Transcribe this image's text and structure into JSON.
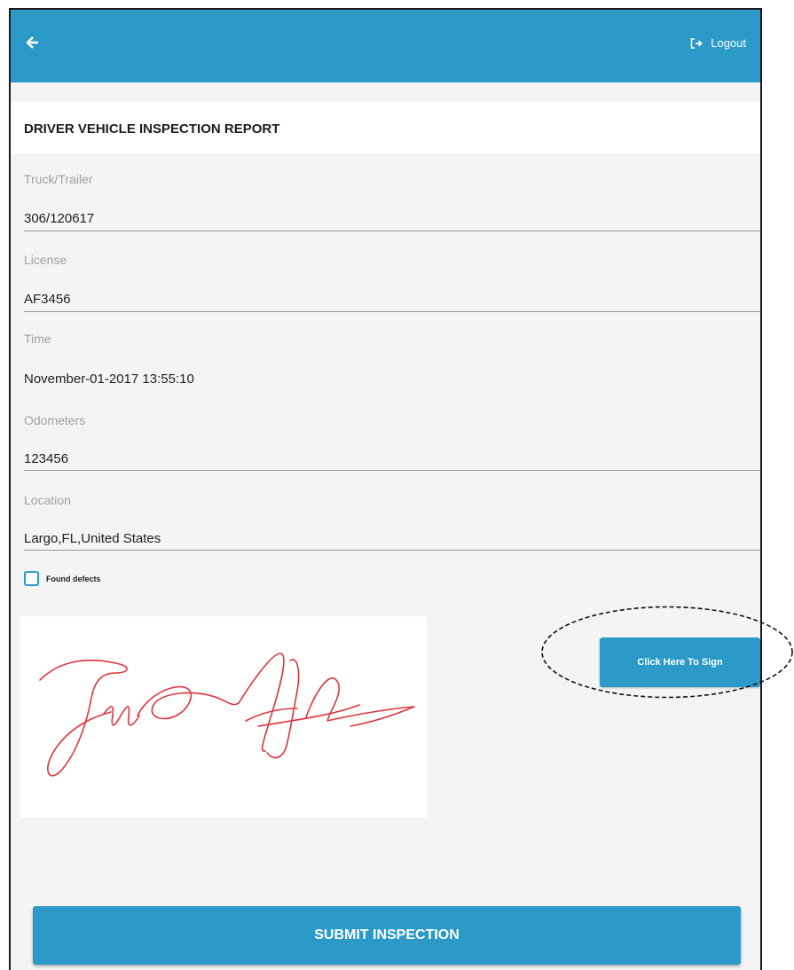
{
  "topbar": {
    "back_icon": "arrow-left-icon",
    "logout_icon": "sign-out-icon",
    "logout_label": "Logout"
  },
  "page_title": "DRIVER VEHICLE INSPECTION REPORT",
  "fields": [
    {
      "label": "Truck/Trailer",
      "value": "306/120617"
    },
    {
      "label": "License",
      "value": "AF3456"
    },
    {
      "label": "Time",
      "value": "November-01-2017 13:55:10"
    },
    {
      "label": "Odometers",
      "value": "123456"
    },
    {
      "label": "Location",
      "value": "Largo,FL,United States"
    }
  ],
  "defects": {
    "label": "Found defects",
    "checked": false
  },
  "signature": {
    "stroke_color": "#e0343c"
  },
  "sign_button_label": "Click Here To Sign",
  "submit_button_label": "SUBMIT INSPECTION",
  "colors": {
    "accent": "#2b9ac9",
    "background": "#f4f4f4"
  }
}
